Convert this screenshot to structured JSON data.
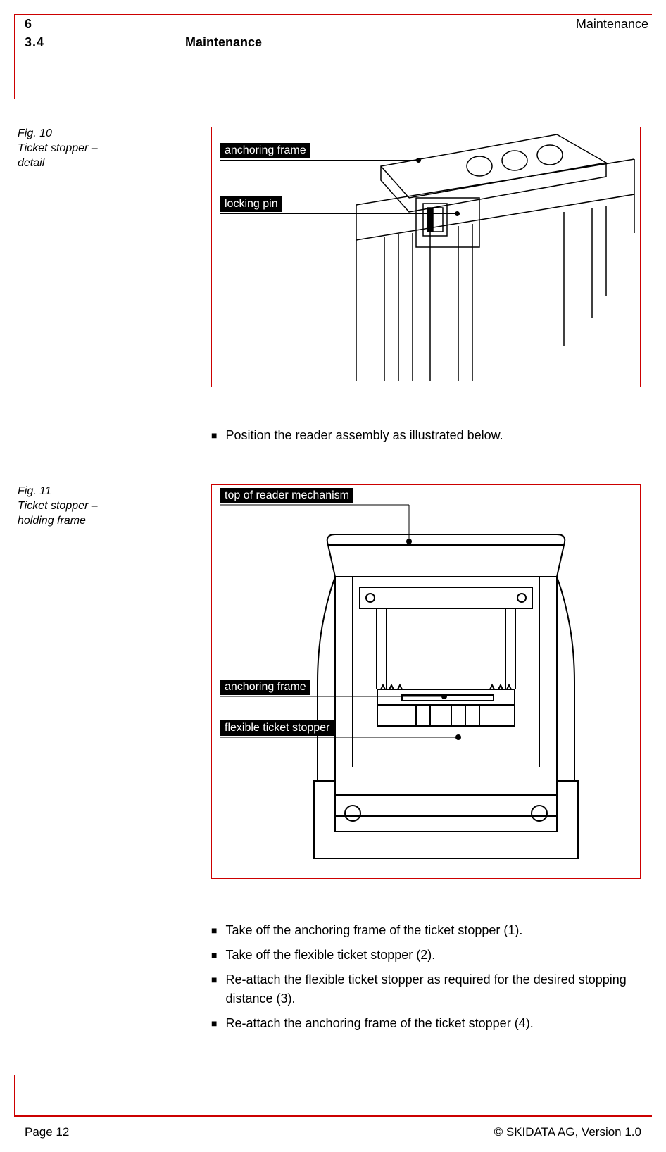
{
  "header": {
    "page_number": "6",
    "category": "Maintenance",
    "section_number": "3.4",
    "section_title": "Maintenance"
  },
  "figures": {
    "fig10": {
      "caption_line1": "Fig. 10",
      "caption_line2": "Ticket stopper –",
      "caption_line3": "detail",
      "callouts": {
        "anchoring_frame": "anchoring frame",
        "locking_pin": "locking pin"
      }
    },
    "fig11": {
      "caption_line1": "Fig. 11",
      "caption_line2": "Ticket stopper –",
      "caption_line3": "holding frame",
      "callouts": {
        "top_of_reader": "top of reader mechanism",
        "anchoring_frame": "anchoring frame",
        "flexible_stopper": "flexible ticket stopper"
      }
    }
  },
  "instructions": {
    "step1": "Position the reader assembly as illustrated below.",
    "step2": "Take off the anchoring frame of the ticket stopper (1).",
    "step3": "Take off the flexible ticket stopper (2).",
    "step4": "Re-attach the flexible ticket stopper as required for the desired stopping distance (3).",
    "step5": "Re-attach the anchoring frame of the ticket stopper (4)."
  },
  "footer": {
    "page": "Page 12",
    "copyright": "© SKIDATA AG, Version 1.0"
  }
}
